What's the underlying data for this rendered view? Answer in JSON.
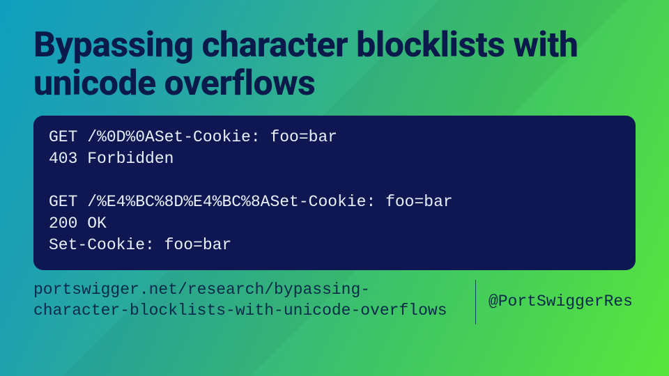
{
  "title": "Bypassing character blocklists with unicode overflows",
  "code": {
    "line1": "GET /%0D%0ASet-Cookie: foo=bar",
    "line2": "403 Forbidden",
    "blank": "",
    "line3": "GET /%E4%BC%8D%E4%BC%8ASet-Cookie: foo=bar",
    "line4": "200 OK",
    "line5": "Set-Cookie: foo=bar"
  },
  "url": "portswigger.net/research/bypassing-character-blocklists-with-unicode-overflows",
  "handle": "@PortSwiggerRes"
}
